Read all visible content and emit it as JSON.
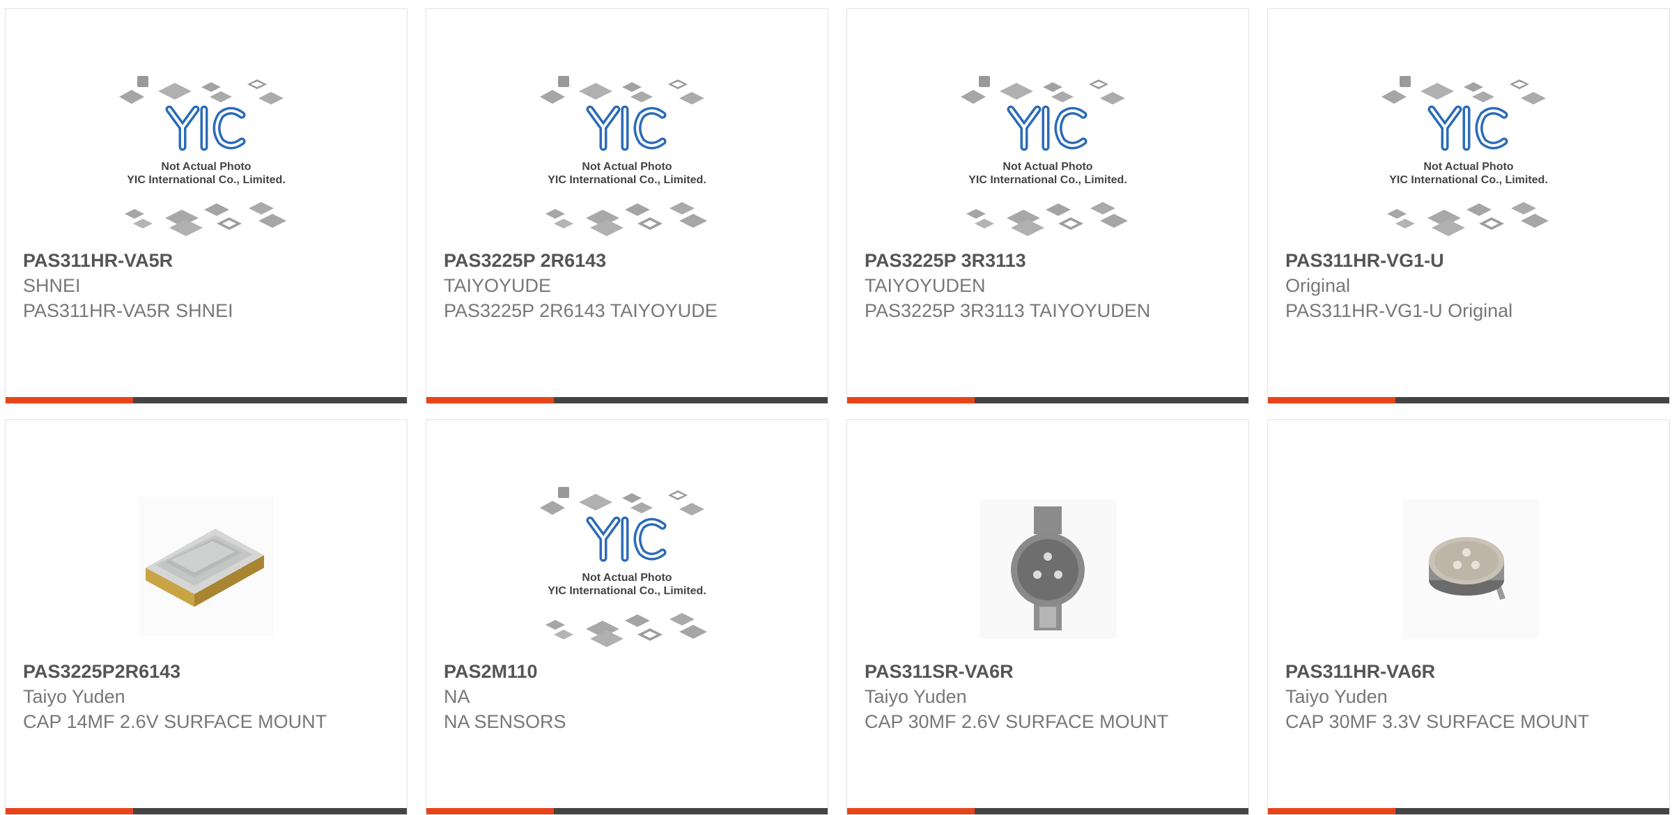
{
  "accent_color": "#e8441a",
  "placeholder_caption": [
    "Not Actual Photo",
    "YIC International Co., Limited."
  ],
  "products": [
    {
      "part": "PAS311HR-VA5R",
      "maker": "SHNEI",
      "desc": "PAS311HR-VA5R SHNEI",
      "image": "yic-placeholder"
    },
    {
      "part": "PAS3225P 2R6143",
      "maker": "TAIYOYUDE",
      "desc": "PAS3225P 2R6143 TAIYOYUDE",
      "image": "yic-placeholder"
    },
    {
      "part": "PAS3225P 3R3113",
      "maker": "TAIYOYUDEN",
      "desc": "PAS3225P 3R3113 TAIYOYUDEN",
      "image": "yic-placeholder"
    },
    {
      "part": "PAS311HR-VG1-U",
      "maker": "Original",
      "desc": "PAS311HR-VG1-U Original",
      "image": "yic-placeholder"
    },
    {
      "part": "PAS3225P2R6143",
      "maker": "Taiyo Yuden",
      "desc": "CAP 14MF 2.6V SURFACE MOUNT",
      "image": "smd-capacitor-photo"
    },
    {
      "part": "PAS2M110",
      "maker": "NA",
      "desc": "NA SENSORS",
      "image": "yic-placeholder"
    },
    {
      "part": "PAS311SR-VA6R",
      "maker": "Taiyo Yuden",
      "desc": "CAP 30MF 2.6V SURFACE MOUNT",
      "image": "coin-capacitor-photo"
    },
    {
      "part": "PAS311HR-VA6R",
      "maker": "Taiyo Yuden",
      "desc": "CAP 30MF 3.3V SURFACE MOUNT",
      "image": "coin-capacitor-tab-photo"
    }
  ]
}
